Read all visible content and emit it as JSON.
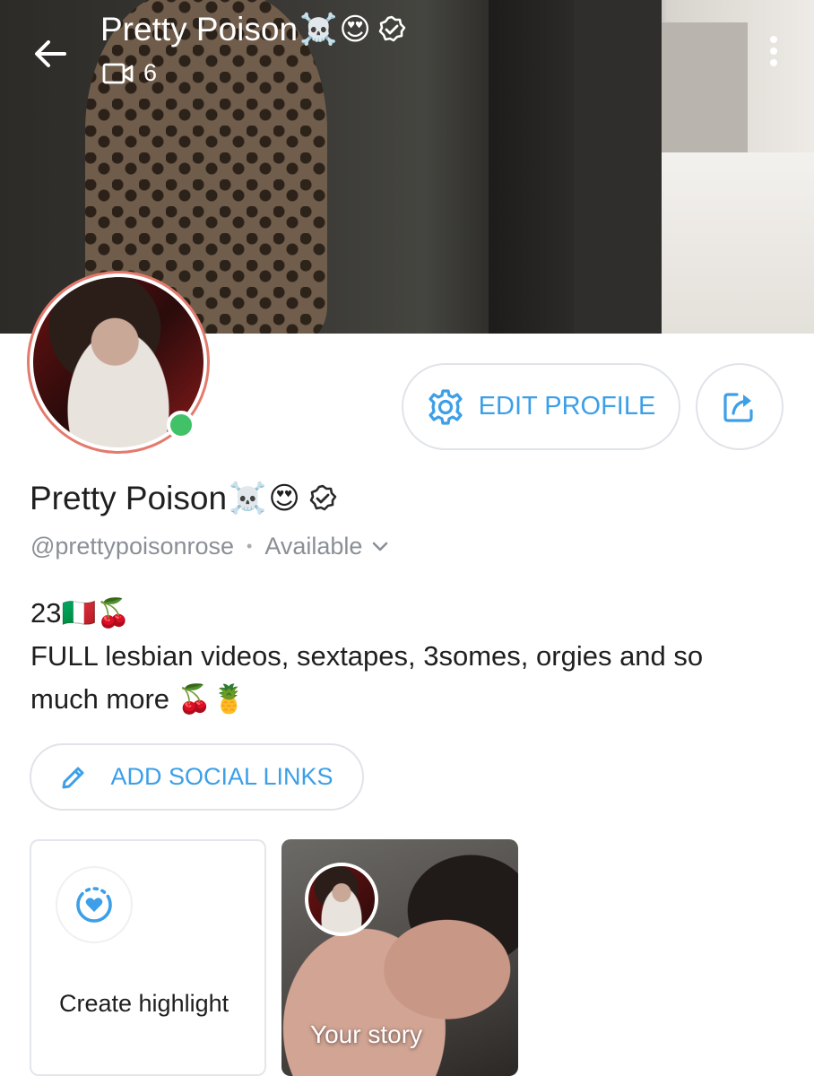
{
  "header": {
    "title": "Pretty Poison",
    "title_emojis": [
      "☠️",
      "😍"
    ],
    "verified_icon": "verified-badge-icon",
    "media_count": "6",
    "media_icon": "video-camera-icon",
    "back_icon": "arrow-left-icon",
    "menu_icon": "more-vertical-icon"
  },
  "profile": {
    "name": "Pretty Poison",
    "name_emojis": [
      "☠️",
      "😍"
    ],
    "handle": "@prettypoisonrose",
    "separator": "•",
    "status": "Available",
    "online": true,
    "bio_line1": "23🇮🇹🍒",
    "bio_line2": "FULL lesbian videos, sextapes, 3somes, orgies and so much more 🍒🍍"
  },
  "actions": {
    "edit_profile_label": "EDIT PROFILE",
    "add_social_links_label": "ADD SOCIAL LINKS"
  },
  "highlights": {
    "create_label": "Create highlight",
    "story_label": "Your story"
  },
  "colors": {
    "accent": "#3c9fe8",
    "avatar_ring": "#e47a6d",
    "online": "#42c268",
    "muted_text": "#8a8f96"
  }
}
